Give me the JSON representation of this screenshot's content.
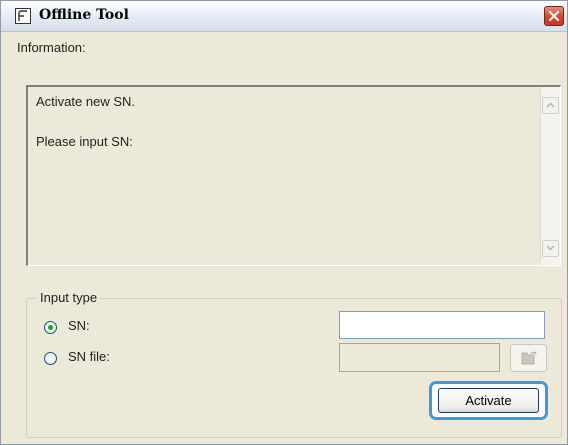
{
  "window": {
    "title": "Offline Tool",
    "close_icon": "close-icon",
    "app_icon": "app-logo-icon"
  },
  "information": {
    "label": "Information:",
    "lines": [
      "Activate new SN.",
      "Please input SN:"
    ],
    "scroll_up_icon": "scroll-up-icon",
    "scroll_down_icon": "scroll-down-icon"
  },
  "input_type": {
    "legend": "Input type",
    "options": [
      {
        "label": "SN:",
        "selected": true
      },
      {
        "label": "SN file:",
        "selected": false
      }
    ],
    "sn_value": "",
    "sn_file_value": "",
    "browse_icon": "folder-open-icon"
  },
  "actions": {
    "activate_label": "Activate"
  },
  "colors": {
    "focus_ring": "#3c9bd8",
    "close_button": "#d2472e",
    "radio_dot": "#21a121"
  }
}
